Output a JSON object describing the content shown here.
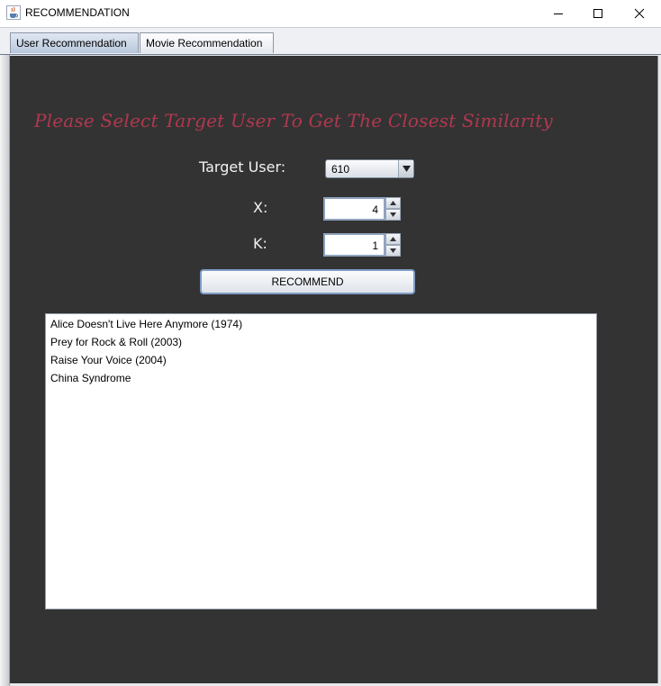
{
  "window": {
    "title": "RECOMMENDATION",
    "icon": "java-cup-icon"
  },
  "tabs": [
    {
      "label": "User Recommendation",
      "selected": true
    },
    {
      "label": "Movie Recommendation",
      "selected": false
    }
  ],
  "main": {
    "headline": "Please Select Target User To Get The Closest Similarity",
    "target_user_label": "Target User:",
    "target_user_value": "610",
    "x_label": "X:",
    "x_value": "4",
    "k_label": "K:",
    "k_value": "1",
    "recommend_button": "RECOMMEND",
    "results": [
      "Alice Doesn't Live Here Anymore (1974)",
      "Prey for Rock & Roll (2003)",
      "Raise Your Voice (2004)",
      "China Syndrome"
    ]
  },
  "colors": {
    "panel_background": "#333333",
    "headline": "#b0384f",
    "label_text": "#f2f2f2"
  }
}
